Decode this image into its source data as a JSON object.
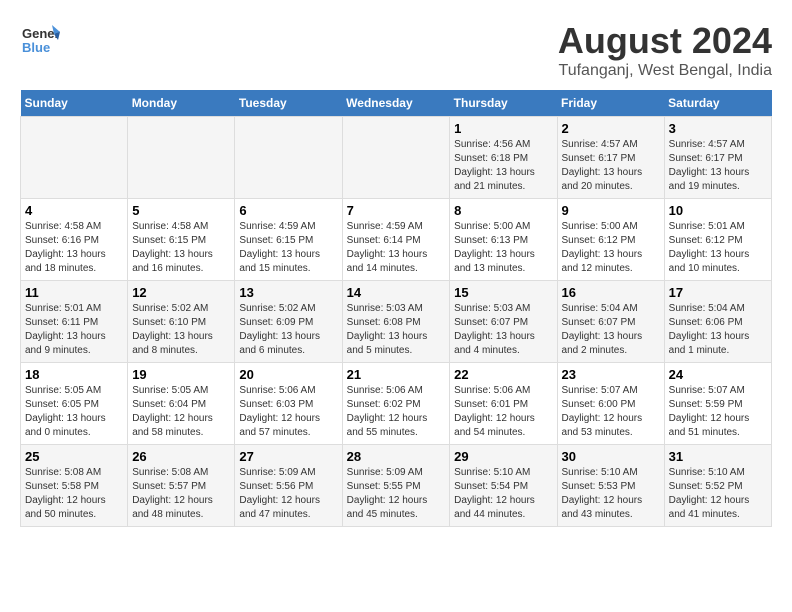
{
  "logo": {
    "line1": "General",
    "line2": "Blue"
  },
  "title": "August 2024",
  "subtitle": "Tufanganj, West Bengal, India",
  "days_of_week": [
    "Sunday",
    "Monday",
    "Tuesday",
    "Wednesday",
    "Thursday",
    "Friday",
    "Saturday"
  ],
  "weeks": [
    [
      {
        "day": "",
        "sunrise": "",
        "sunset": "",
        "daylight": ""
      },
      {
        "day": "",
        "sunrise": "",
        "sunset": "",
        "daylight": ""
      },
      {
        "day": "",
        "sunrise": "",
        "sunset": "",
        "daylight": ""
      },
      {
        "day": "",
        "sunrise": "",
        "sunset": "",
        "daylight": ""
      },
      {
        "day": "1",
        "sunrise": "Sunrise: 4:56 AM",
        "sunset": "Sunset: 6:18 PM",
        "daylight": "Daylight: 13 hours and 21 minutes."
      },
      {
        "day": "2",
        "sunrise": "Sunrise: 4:57 AM",
        "sunset": "Sunset: 6:17 PM",
        "daylight": "Daylight: 13 hours and 20 minutes."
      },
      {
        "day": "3",
        "sunrise": "Sunrise: 4:57 AM",
        "sunset": "Sunset: 6:17 PM",
        "daylight": "Daylight: 13 hours and 19 minutes."
      }
    ],
    [
      {
        "day": "4",
        "sunrise": "Sunrise: 4:58 AM",
        "sunset": "Sunset: 6:16 PM",
        "daylight": "Daylight: 13 hours and 18 minutes."
      },
      {
        "day": "5",
        "sunrise": "Sunrise: 4:58 AM",
        "sunset": "Sunset: 6:15 PM",
        "daylight": "Daylight: 13 hours and 16 minutes."
      },
      {
        "day": "6",
        "sunrise": "Sunrise: 4:59 AM",
        "sunset": "Sunset: 6:15 PM",
        "daylight": "Daylight: 13 hours and 15 minutes."
      },
      {
        "day": "7",
        "sunrise": "Sunrise: 4:59 AM",
        "sunset": "Sunset: 6:14 PM",
        "daylight": "Daylight: 13 hours and 14 minutes."
      },
      {
        "day": "8",
        "sunrise": "Sunrise: 5:00 AM",
        "sunset": "Sunset: 6:13 PM",
        "daylight": "Daylight: 13 hours and 13 minutes."
      },
      {
        "day": "9",
        "sunrise": "Sunrise: 5:00 AM",
        "sunset": "Sunset: 6:12 PM",
        "daylight": "Daylight: 13 hours and 12 minutes."
      },
      {
        "day": "10",
        "sunrise": "Sunrise: 5:01 AM",
        "sunset": "Sunset: 6:12 PM",
        "daylight": "Daylight: 13 hours and 10 minutes."
      }
    ],
    [
      {
        "day": "11",
        "sunrise": "Sunrise: 5:01 AM",
        "sunset": "Sunset: 6:11 PM",
        "daylight": "Daylight: 13 hours and 9 minutes."
      },
      {
        "day": "12",
        "sunrise": "Sunrise: 5:02 AM",
        "sunset": "Sunset: 6:10 PM",
        "daylight": "Daylight: 13 hours and 8 minutes."
      },
      {
        "day": "13",
        "sunrise": "Sunrise: 5:02 AM",
        "sunset": "Sunset: 6:09 PM",
        "daylight": "Daylight: 13 hours and 6 minutes."
      },
      {
        "day": "14",
        "sunrise": "Sunrise: 5:03 AM",
        "sunset": "Sunset: 6:08 PM",
        "daylight": "Daylight: 13 hours and 5 minutes."
      },
      {
        "day": "15",
        "sunrise": "Sunrise: 5:03 AM",
        "sunset": "Sunset: 6:07 PM",
        "daylight": "Daylight: 13 hours and 4 minutes."
      },
      {
        "day": "16",
        "sunrise": "Sunrise: 5:04 AM",
        "sunset": "Sunset: 6:07 PM",
        "daylight": "Daylight: 13 hours and 2 minutes."
      },
      {
        "day": "17",
        "sunrise": "Sunrise: 5:04 AM",
        "sunset": "Sunset: 6:06 PM",
        "daylight": "Daylight: 13 hours and 1 minute."
      }
    ],
    [
      {
        "day": "18",
        "sunrise": "Sunrise: 5:05 AM",
        "sunset": "Sunset: 6:05 PM",
        "daylight": "Daylight: 13 hours and 0 minutes."
      },
      {
        "day": "19",
        "sunrise": "Sunrise: 5:05 AM",
        "sunset": "Sunset: 6:04 PM",
        "daylight": "Daylight: 12 hours and 58 minutes."
      },
      {
        "day": "20",
        "sunrise": "Sunrise: 5:06 AM",
        "sunset": "Sunset: 6:03 PM",
        "daylight": "Daylight: 12 hours and 57 minutes."
      },
      {
        "day": "21",
        "sunrise": "Sunrise: 5:06 AM",
        "sunset": "Sunset: 6:02 PM",
        "daylight": "Daylight: 12 hours and 55 minutes."
      },
      {
        "day": "22",
        "sunrise": "Sunrise: 5:06 AM",
        "sunset": "Sunset: 6:01 PM",
        "daylight": "Daylight: 12 hours and 54 minutes."
      },
      {
        "day": "23",
        "sunrise": "Sunrise: 5:07 AM",
        "sunset": "Sunset: 6:00 PM",
        "daylight": "Daylight: 12 hours and 53 minutes."
      },
      {
        "day": "24",
        "sunrise": "Sunrise: 5:07 AM",
        "sunset": "Sunset: 5:59 PM",
        "daylight": "Daylight: 12 hours and 51 minutes."
      }
    ],
    [
      {
        "day": "25",
        "sunrise": "Sunrise: 5:08 AM",
        "sunset": "Sunset: 5:58 PM",
        "daylight": "Daylight: 12 hours and 50 minutes."
      },
      {
        "day": "26",
        "sunrise": "Sunrise: 5:08 AM",
        "sunset": "Sunset: 5:57 PM",
        "daylight": "Daylight: 12 hours and 48 minutes."
      },
      {
        "day": "27",
        "sunrise": "Sunrise: 5:09 AM",
        "sunset": "Sunset: 5:56 PM",
        "daylight": "Daylight: 12 hours and 47 minutes."
      },
      {
        "day": "28",
        "sunrise": "Sunrise: 5:09 AM",
        "sunset": "Sunset: 5:55 PM",
        "daylight": "Daylight: 12 hours and 45 minutes."
      },
      {
        "day": "29",
        "sunrise": "Sunrise: 5:10 AM",
        "sunset": "Sunset: 5:54 PM",
        "daylight": "Daylight: 12 hours and 44 minutes."
      },
      {
        "day": "30",
        "sunrise": "Sunrise: 5:10 AM",
        "sunset": "Sunset: 5:53 PM",
        "daylight": "Daylight: 12 hours and 43 minutes."
      },
      {
        "day": "31",
        "sunrise": "Sunrise: 5:10 AM",
        "sunset": "Sunset: 5:52 PM",
        "daylight": "Daylight: 12 hours and 41 minutes."
      }
    ]
  ]
}
